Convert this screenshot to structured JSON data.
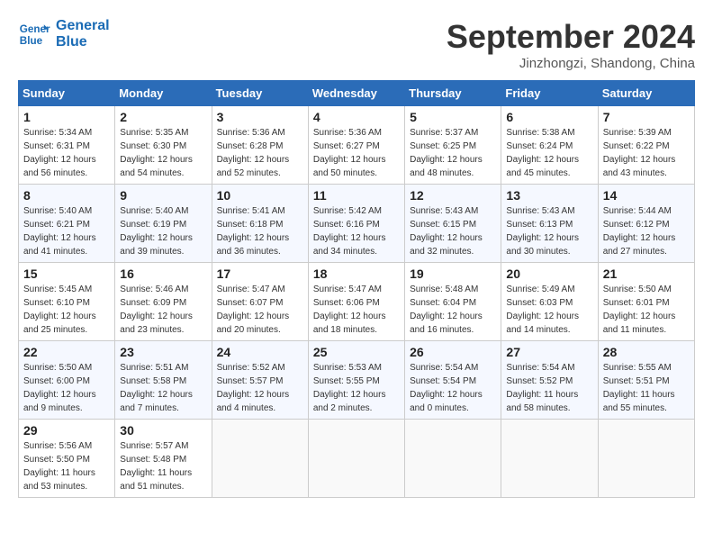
{
  "header": {
    "logo_line1": "General",
    "logo_line2": "Blue",
    "month": "September 2024",
    "location": "Jinzhongzi, Shandong, China"
  },
  "days_of_week": [
    "Sunday",
    "Monday",
    "Tuesday",
    "Wednesday",
    "Thursday",
    "Friday",
    "Saturday"
  ],
  "weeks": [
    [
      {
        "day": "1",
        "info": "Sunrise: 5:34 AM\nSunset: 6:31 PM\nDaylight: 12 hours\nand 56 minutes."
      },
      {
        "day": "2",
        "info": "Sunrise: 5:35 AM\nSunset: 6:30 PM\nDaylight: 12 hours\nand 54 minutes."
      },
      {
        "day": "3",
        "info": "Sunrise: 5:36 AM\nSunset: 6:28 PM\nDaylight: 12 hours\nand 52 minutes."
      },
      {
        "day": "4",
        "info": "Sunrise: 5:36 AM\nSunset: 6:27 PM\nDaylight: 12 hours\nand 50 minutes."
      },
      {
        "day": "5",
        "info": "Sunrise: 5:37 AM\nSunset: 6:25 PM\nDaylight: 12 hours\nand 48 minutes."
      },
      {
        "day": "6",
        "info": "Sunrise: 5:38 AM\nSunset: 6:24 PM\nDaylight: 12 hours\nand 45 minutes."
      },
      {
        "day": "7",
        "info": "Sunrise: 5:39 AM\nSunset: 6:22 PM\nDaylight: 12 hours\nand 43 minutes."
      }
    ],
    [
      {
        "day": "8",
        "info": "Sunrise: 5:40 AM\nSunset: 6:21 PM\nDaylight: 12 hours\nand 41 minutes."
      },
      {
        "day": "9",
        "info": "Sunrise: 5:40 AM\nSunset: 6:19 PM\nDaylight: 12 hours\nand 39 minutes."
      },
      {
        "day": "10",
        "info": "Sunrise: 5:41 AM\nSunset: 6:18 PM\nDaylight: 12 hours\nand 36 minutes."
      },
      {
        "day": "11",
        "info": "Sunrise: 5:42 AM\nSunset: 6:16 PM\nDaylight: 12 hours\nand 34 minutes."
      },
      {
        "day": "12",
        "info": "Sunrise: 5:43 AM\nSunset: 6:15 PM\nDaylight: 12 hours\nand 32 minutes."
      },
      {
        "day": "13",
        "info": "Sunrise: 5:43 AM\nSunset: 6:13 PM\nDaylight: 12 hours\nand 30 minutes."
      },
      {
        "day": "14",
        "info": "Sunrise: 5:44 AM\nSunset: 6:12 PM\nDaylight: 12 hours\nand 27 minutes."
      }
    ],
    [
      {
        "day": "15",
        "info": "Sunrise: 5:45 AM\nSunset: 6:10 PM\nDaylight: 12 hours\nand 25 minutes."
      },
      {
        "day": "16",
        "info": "Sunrise: 5:46 AM\nSunset: 6:09 PM\nDaylight: 12 hours\nand 23 minutes."
      },
      {
        "day": "17",
        "info": "Sunrise: 5:47 AM\nSunset: 6:07 PM\nDaylight: 12 hours\nand 20 minutes."
      },
      {
        "day": "18",
        "info": "Sunrise: 5:47 AM\nSunset: 6:06 PM\nDaylight: 12 hours\nand 18 minutes."
      },
      {
        "day": "19",
        "info": "Sunrise: 5:48 AM\nSunset: 6:04 PM\nDaylight: 12 hours\nand 16 minutes."
      },
      {
        "day": "20",
        "info": "Sunrise: 5:49 AM\nSunset: 6:03 PM\nDaylight: 12 hours\nand 14 minutes."
      },
      {
        "day": "21",
        "info": "Sunrise: 5:50 AM\nSunset: 6:01 PM\nDaylight: 12 hours\nand 11 minutes."
      }
    ],
    [
      {
        "day": "22",
        "info": "Sunrise: 5:50 AM\nSunset: 6:00 PM\nDaylight: 12 hours\nand 9 minutes."
      },
      {
        "day": "23",
        "info": "Sunrise: 5:51 AM\nSunset: 5:58 PM\nDaylight: 12 hours\nand 7 minutes."
      },
      {
        "day": "24",
        "info": "Sunrise: 5:52 AM\nSunset: 5:57 PM\nDaylight: 12 hours\nand 4 minutes."
      },
      {
        "day": "25",
        "info": "Sunrise: 5:53 AM\nSunset: 5:55 PM\nDaylight: 12 hours\nand 2 minutes."
      },
      {
        "day": "26",
        "info": "Sunrise: 5:54 AM\nSunset: 5:54 PM\nDaylight: 12 hours\nand 0 minutes."
      },
      {
        "day": "27",
        "info": "Sunrise: 5:54 AM\nSunset: 5:52 PM\nDaylight: 11 hours\nand 58 minutes."
      },
      {
        "day": "28",
        "info": "Sunrise: 5:55 AM\nSunset: 5:51 PM\nDaylight: 11 hours\nand 55 minutes."
      }
    ],
    [
      {
        "day": "29",
        "info": "Sunrise: 5:56 AM\nSunset: 5:50 PM\nDaylight: 11 hours\nand 53 minutes."
      },
      {
        "day": "30",
        "info": "Sunrise: 5:57 AM\nSunset: 5:48 PM\nDaylight: 11 hours\nand 51 minutes."
      },
      {
        "day": "",
        "info": ""
      },
      {
        "day": "",
        "info": ""
      },
      {
        "day": "",
        "info": ""
      },
      {
        "day": "",
        "info": ""
      },
      {
        "day": "",
        "info": ""
      }
    ]
  ]
}
